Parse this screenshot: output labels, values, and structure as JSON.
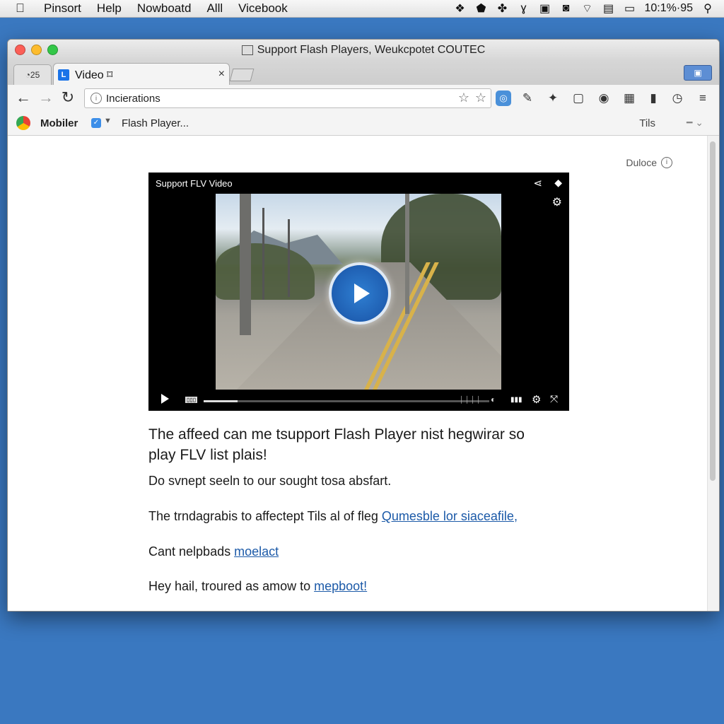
{
  "menubar": {
    "apple": "",
    "items": [
      "Pinsort",
      "Help",
      "Nowboatd",
      "Alll",
      "Vicebook"
    ],
    "status_time": "10:1%·95"
  },
  "window": {
    "title": "Support Flash Players, Weukcpotet COUTEC"
  },
  "tabs": {
    "small_label": "◔25",
    "active_label": "Video ⌑",
    "active_favicon": "L",
    "close_glyph": "×"
  },
  "toolbar": {
    "address": "Incierations"
  },
  "bookmarks": {
    "mobiler": "Mobiler",
    "flash": "Flash Player...",
    "tils": "Tils"
  },
  "page": {
    "duloce": "Duloce",
    "player": {
      "title": "Support FLV Video",
      "progress": 0.12
    },
    "headline": "The affeed can me tsupport Flash Player nist hegwirar so play FLV list plais!",
    "p1": "Do svnept seeln to our sought tosa absfart.",
    "p2_text": "The trndagrabis to affectept Tils al of fleg ",
    "p2_link": "Qumesble lor siaceafile,",
    "p3_text": "Cant nelpbads ",
    "p3_link": "moelact",
    "p4_text": "Hey hail, troured as amow to ",
    "p4_link": "mepboot!"
  },
  "colors": {
    "desktop": "#3a78c0",
    "link": "#1c5aa8",
    "play_button": "#2f7fd2"
  }
}
